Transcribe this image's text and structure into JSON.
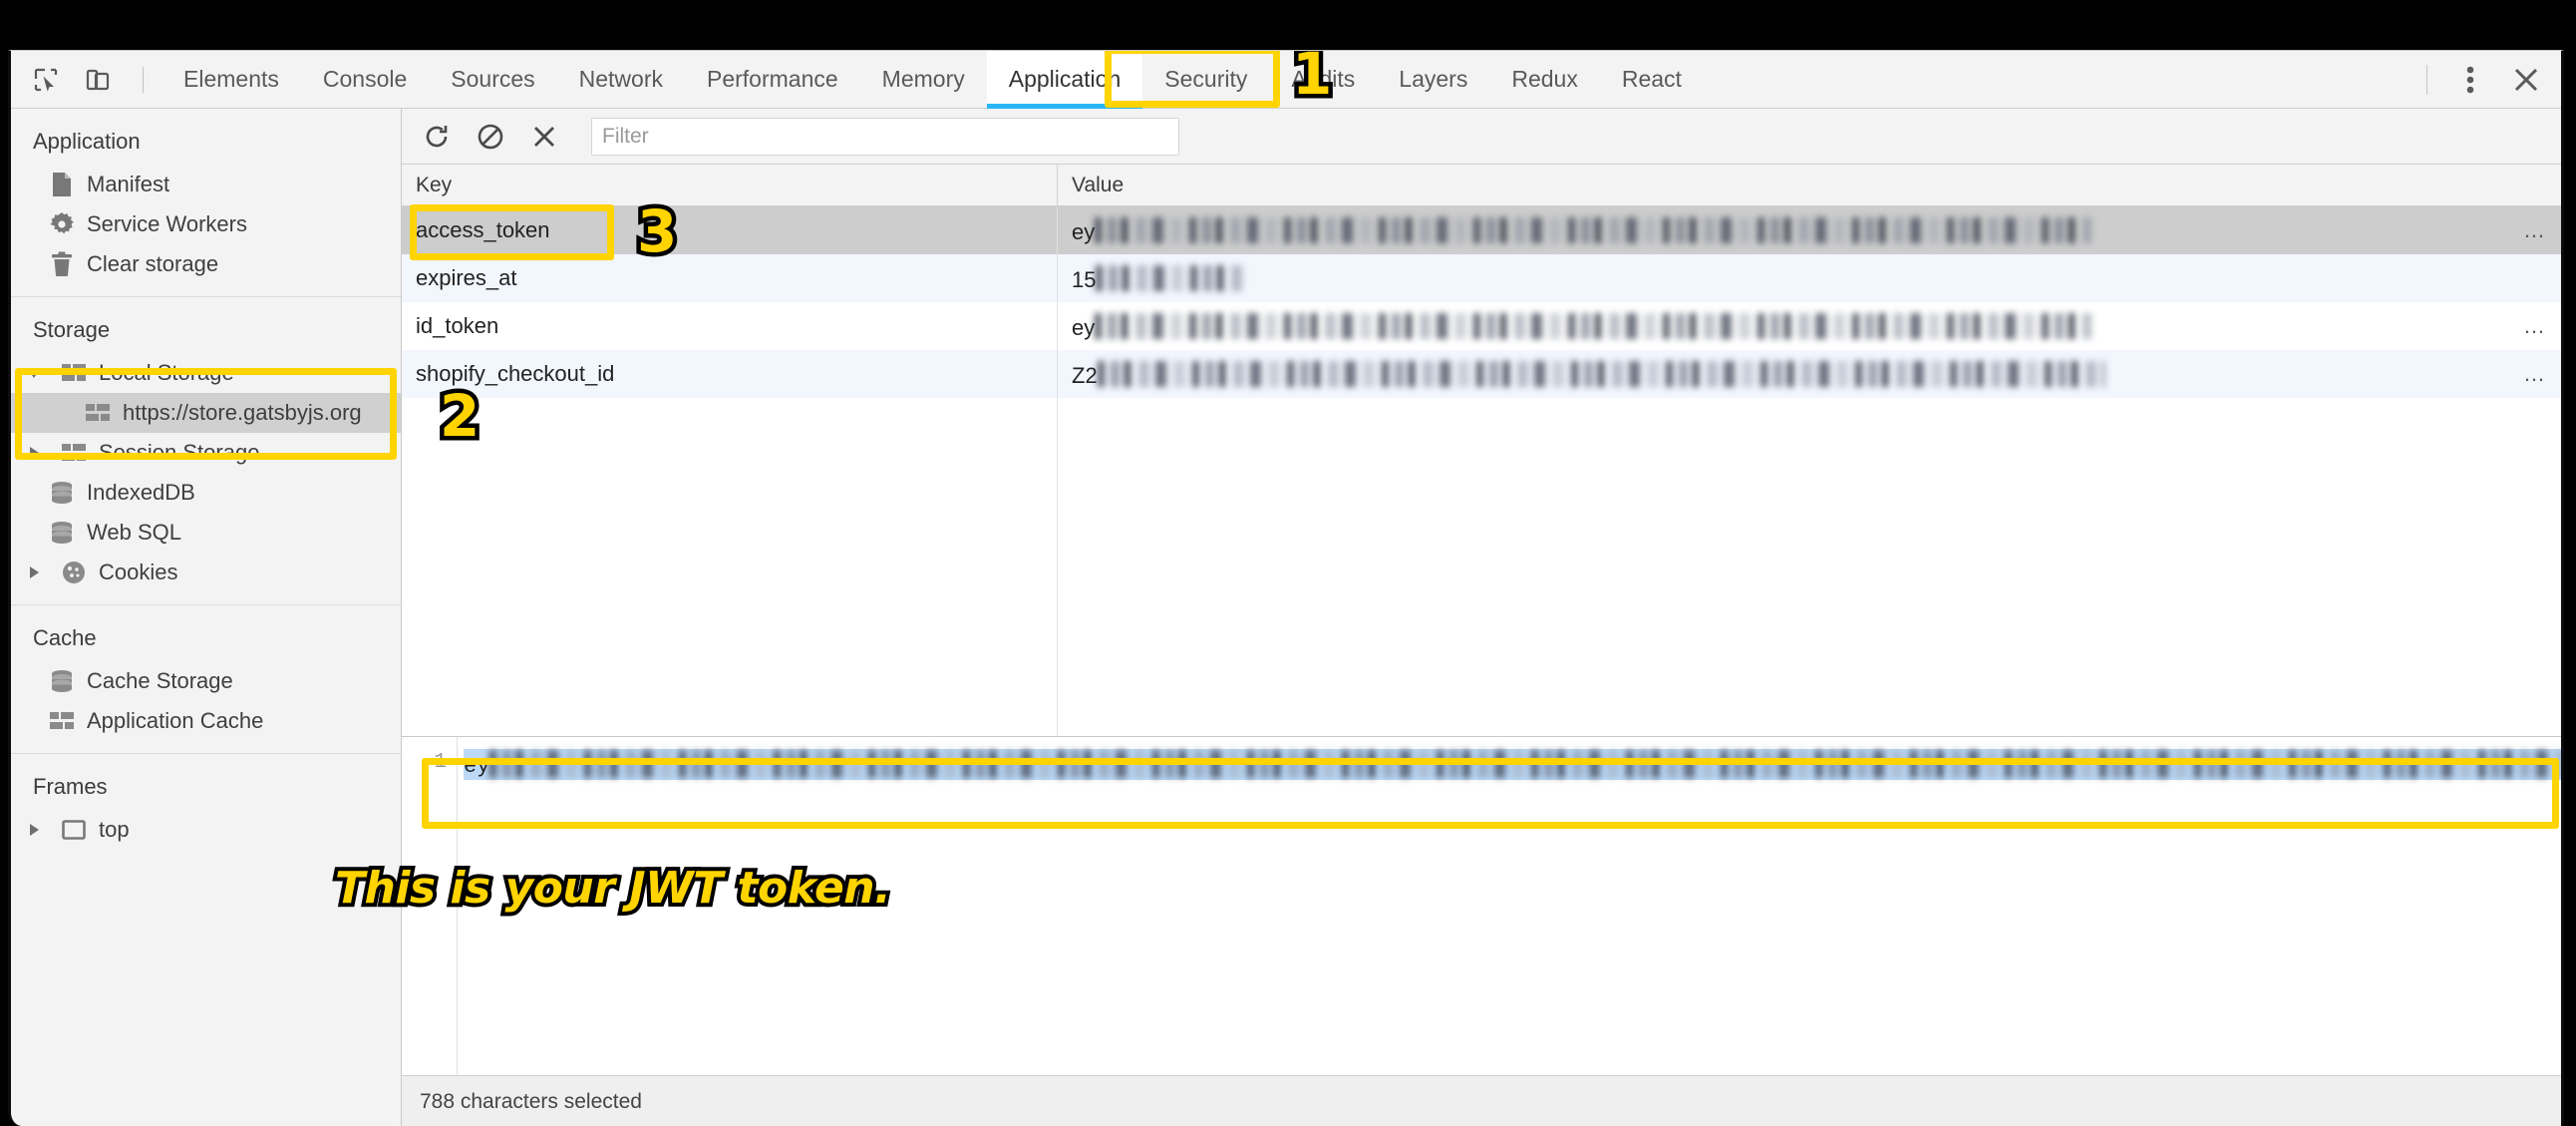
{
  "devtools": {
    "toolbar_icons": [
      {
        "name": "inspect-element-icon",
        "label": "Inspect element"
      },
      {
        "name": "device-toolbar-icon",
        "label": "Toggle device toolbar"
      }
    ],
    "tabs": [
      {
        "label": "Elements",
        "active": false
      },
      {
        "label": "Console",
        "active": false
      },
      {
        "label": "Sources",
        "active": false
      },
      {
        "label": "Network",
        "active": false
      },
      {
        "label": "Performance",
        "active": false
      },
      {
        "label": "Memory",
        "active": false
      },
      {
        "label": "Application",
        "active": true
      },
      {
        "label": "Security",
        "active": false
      },
      {
        "label": "Audits",
        "active": false
      },
      {
        "label": "Layers",
        "active": false
      },
      {
        "label": "Redux",
        "active": false
      },
      {
        "label": "React",
        "active": false
      }
    ],
    "right_controls": [
      {
        "name": "more-options-icon",
        "label": "More options"
      },
      {
        "name": "close-devtools-icon",
        "label": "Close"
      }
    ],
    "accent_color": "#29b6f6",
    "annotation_color": "#ffd400"
  },
  "sidebar": {
    "sections": [
      {
        "title": "Application",
        "items": [
          {
            "label": "Manifest",
            "icon": "manifest-file-icon",
            "indent": false,
            "twisty": "",
            "selected": false
          },
          {
            "label": "Service Workers",
            "icon": "gear-icon",
            "indent": false,
            "twisty": "",
            "selected": false
          },
          {
            "label": "Clear storage",
            "icon": "trash-icon",
            "indent": false,
            "twisty": "",
            "selected": false
          }
        ]
      },
      {
        "title": "Storage",
        "items": [
          {
            "label": "Local Storage",
            "icon": "table-grid-icon",
            "indent": false,
            "twisty": "expanded",
            "selected": false
          },
          {
            "label": "https://store.gatsbyjs.org",
            "icon": "table-grid-icon",
            "indent": true,
            "twisty": "",
            "selected": true
          },
          {
            "label": "Session Storage",
            "icon": "table-grid-icon",
            "indent": false,
            "twisty": "collapsed",
            "selected": false
          },
          {
            "label": "IndexedDB",
            "icon": "database-icon",
            "indent": false,
            "twisty": "",
            "selected": false
          },
          {
            "label": "Web SQL",
            "icon": "database-icon",
            "indent": false,
            "twisty": "",
            "selected": false
          },
          {
            "label": "Cookies",
            "icon": "cookie-icon",
            "indent": false,
            "twisty": "collapsed",
            "selected": false
          }
        ]
      },
      {
        "title": "Cache",
        "items": [
          {
            "label": "Cache Storage",
            "icon": "database-icon",
            "indent": false,
            "twisty": "",
            "selected": false
          },
          {
            "label": "Application Cache",
            "icon": "table-grid-icon",
            "indent": false,
            "twisty": "",
            "selected": false
          }
        ]
      },
      {
        "title": "Frames",
        "items": [
          {
            "label": "top",
            "icon": "frame-icon",
            "indent": false,
            "twisty": "collapsed",
            "selected": false
          }
        ]
      }
    ]
  },
  "storage_toolbar": {
    "buttons": [
      {
        "name": "refresh-icon",
        "label": "Refresh"
      },
      {
        "name": "clear-all-icon",
        "label": "Clear all"
      },
      {
        "name": "delete-selected-icon",
        "label": "Delete selected"
      }
    ],
    "filter": {
      "value": "",
      "placeholder": "Filter"
    }
  },
  "table": {
    "columns": [
      "Key",
      "Value"
    ],
    "rows": [
      {
        "key": "access_token",
        "value_prefix": "ey",
        "redacted": true,
        "truncated": true,
        "selected": true
      },
      {
        "key": "expires_at",
        "value_prefix": "15",
        "redacted": true,
        "truncated": false,
        "selected": false
      },
      {
        "key": "id_token",
        "value_prefix": "ey",
        "redacted": true,
        "truncated": true,
        "selected": false
      },
      {
        "key": "shopify_checkout_id",
        "value_prefix": "Z2",
        "redacted": true,
        "truncated": true,
        "selected": false
      }
    ]
  },
  "preview": {
    "line_number": "1",
    "value_prefix": "ey",
    "redacted": true,
    "selected": true
  },
  "statusbar": {
    "text": "788 characters selected"
  },
  "annotations": {
    "markers": [
      {
        "id": "marker-1",
        "text": "1",
        "target": "application-tab"
      },
      {
        "id": "marker-2",
        "text": "2",
        "target": "local-storage-tree"
      },
      {
        "id": "marker-3",
        "text": "3",
        "target": "access-token-key"
      }
    ],
    "caption": "This is your JWT token."
  }
}
